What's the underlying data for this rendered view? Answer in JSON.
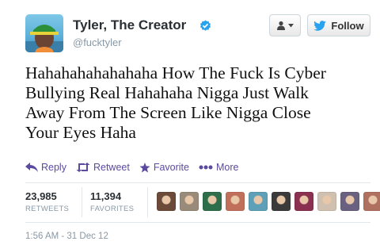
{
  "user": {
    "name": "Tyler, The Creator",
    "handle": "@fucktyler"
  },
  "buttons": {
    "follow_label": "Follow"
  },
  "tweet": {
    "text_lines": [
      "Hahahahahahahaha How The Fuck Is Cyber",
      "Bullying Real Hahahaha Nigga Just Walk",
      "Away From The Screen Like Nigga Close",
      "Your Eyes Haha"
    ]
  },
  "actions": {
    "reply": "Reply",
    "retweet": "Retweet",
    "favorite": "Favorite",
    "more": "More"
  },
  "stats": {
    "retweets": {
      "value": "23,985",
      "label": "RETWEETS"
    },
    "favorites": {
      "value": "11,394",
      "label": "FAVORITES"
    }
  },
  "favoriters": {
    "avatar_colors": [
      "#6b4a3a",
      "#9a8a7a",
      "#2e6e4a",
      "#c0705a",
      "#5ea0b8",
      "#3a3a3a",
      "#8a3050",
      "#d0c0b0",
      "#6a6080",
      "#b07060"
    ]
  },
  "timestamp": "1:56 AM - 31 Dec 12",
  "colors": {
    "action": "#5b4a9e",
    "verified": "#2aa3ef",
    "bird": "#2aa3ef"
  }
}
